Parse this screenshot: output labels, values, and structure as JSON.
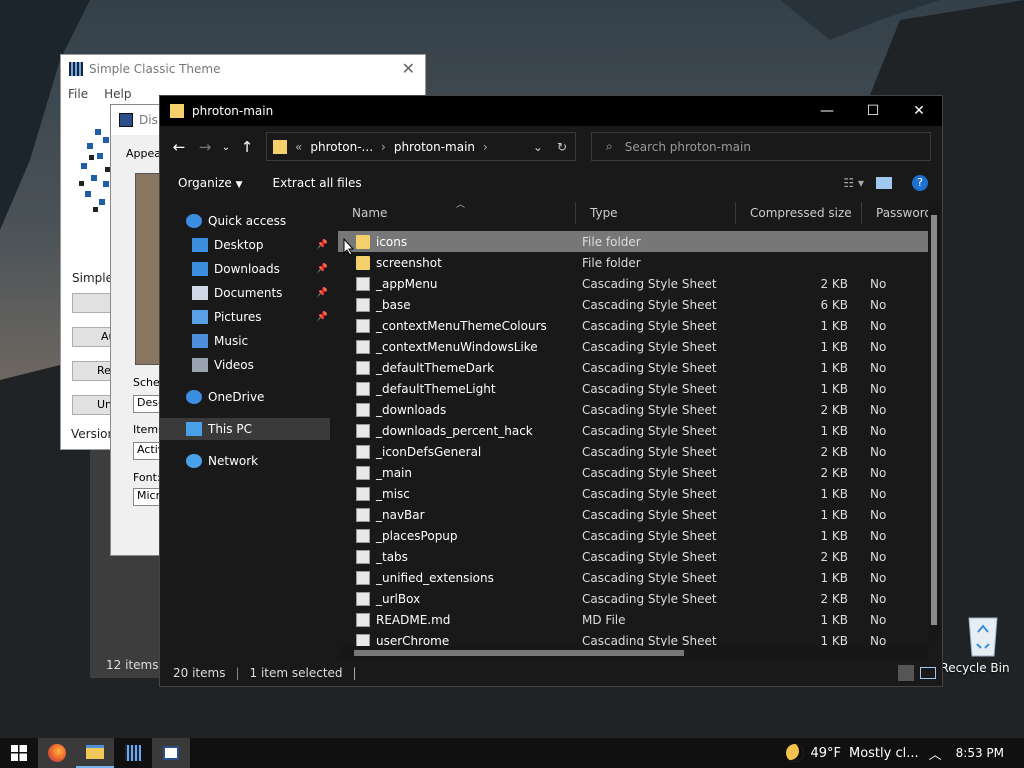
{
  "desktop": {
    "recycle_bin": "Recycle Bin"
  },
  "sct": {
    "title": "Simple Classic Theme",
    "menu": [
      "File",
      "Help"
    ],
    "label_simple": "Simple C",
    "btn1": "Au",
    "btn2": "Res",
    "btn3": "Uni",
    "version": "Version"
  },
  "display": {
    "title": "Dis",
    "appear": "Appear",
    "scheme": "Sche",
    "scheme_val": "Dese",
    "item": "Item:",
    "item_val": "Activ",
    "font": "Font:",
    "font_val": "Micro"
  },
  "behind": {
    "status": "12 items"
  },
  "explorer": {
    "title": "phroton-main",
    "breadcrumb": [
      "phroton-...",
      "phroton-main"
    ],
    "breadcrumb_prefix": "«",
    "search_placeholder": "Search phroton-main",
    "commands": {
      "organize": "Organize",
      "extract": "Extract all files"
    },
    "nav": [
      {
        "label": "Quick access",
        "icon": "star-icon",
        "color": "#3b8ee0",
        "pinned": false
      },
      {
        "label": "Desktop",
        "icon": "desktop-icon",
        "color": "#3b8ee0",
        "pinned": true
      },
      {
        "label": "Downloads",
        "icon": "download-icon",
        "color": "#3b8ee0",
        "pinned": true
      },
      {
        "label": "Documents",
        "icon": "document-icon",
        "color": "#cfd8e4",
        "pinned": true
      },
      {
        "label": "Pictures",
        "icon": "picture-icon",
        "color": "#5aa0e6",
        "pinned": true
      },
      {
        "label": "Music",
        "icon": "music-icon",
        "color": "#4e8fdc",
        "pinned": false
      },
      {
        "label": "Videos",
        "icon": "video-icon",
        "color": "#9aa4b0",
        "pinned": false
      },
      {
        "label": "OneDrive",
        "icon": "cloud-icon",
        "color": "#3b8ee0",
        "pinned": false
      },
      {
        "label": "This PC",
        "icon": "computer-icon",
        "color": "#4aa0e8",
        "pinned": false
      },
      {
        "label": "Network",
        "icon": "network-icon",
        "color": "#4aa0e8",
        "pinned": false
      }
    ],
    "columns": {
      "name": "Name",
      "type": "Type",
      "size": "Compressed size",
      "password": "Password ."
    },
    "files": [
      {
        "name": "icons",
        "type": "File folder",
        "size": "",
        "password": "",
        "kind": "folder",
        "selected": true
      },
      {
        "name": "screenshot",
        "type": "File folder",
        "size": "",
        "password": "",
        "kind": "folder"
      },
      {
        "name": "_appMenu",
        "type": "Cascading Style Sheet Do...",
        "size": "2 KB",
        "password": "No",
        "kind": "css"
      },
      {
        "name": "_base",
        "type": "Cascading Style Sheet Do...",
        "size": "6 KB",
        "password": "No",
        "kind": "css"
      },
      {
        "name": "_contextMenuThemeColours",
        "type": "Cascading Style Sheet Do...",
        "size": "1 KB",
        "password": "No",
        "kind": "css"
      },
      {
        "name": "_contextMenuWindowsLike",
        "type": "Cascading Style Sheet Do...",
        "size": "1 KB",
        "password": "No",
        "kind": "css"
      },
      {
        "name": "_defaultThemeDark",
        "type": "Cascading Style Sheet Do...",
        "size": "1 KB",
        "password": "No",
        "kind": "css"
      },
      {
        "name": "_defaultThemeLight",
        "type": "Cascading Style Sheet Do...",
        "size": "1 KB",
        "password": "No",
        "kind": "css"
      },
      {
        "name": "_downloads",
        "type": "Cascading Style Sheet Do...",
        "size": "2 KB",
        "password": "No",
        "kind": "css"
      },
      {
        "name": "_downloads_percent_hack",
        "type": "Cascading Style Sheet Do...",
        "size": "1 KB",
        "password": "No",
        "kind": "css"
      },
      {
        "name": "_iconDefsGeneral",
        "type": "Cascading Style Sheet Do...",
        "size": "2 KB",
        "password": "No",
        "kind": "css"
      },
      {
        "name": "_main",
        "type": "Cascading Style Sheet Do...",
        "size": "2 KB",
        "password": "No",
        "kind": "css"
      },
      {
        "name": "_misc",
        "type": "Cascading Style Sheet Do...",
        "size": "1 KB",
        "password": "No",
        "kind": "css"
      },
      {
        "name": "_navBar",
        "type": "Cascading Style Sheet Do...",
        "size": "1 KB",
        "password": "No",
        "kind": "css"
      },
      {
        "name": "_placesPopup",
        "type": "Cascading Style Sheet Do...",
        "size": "1 KB",
        "password": "No",
        "kind": "css"
      },
      {
        "name": "_tabs",
        "type": "Cascading Style Sheet Do...",
        "size": "2 KB",
        "password": "No",
        "kind": "css"
      },
      {
        "name": "_unified_extensions",
        "type": "Cascading Style Sheet Do...",
        "size": "1 KB",
        "password": "No",
        "kind": "css"
      },
      {
        "name": "_urlBox",
        "type": "Cascading Style Sheet Do...",
        "size": "2 KB",
        "password": "No",
        "kind": "css"
      },
      {
        "name": "README.md",
        "type": "MD File",
        "size": "1 KB",
        "password": "No",
        "kind": "md"
      },
      {
        "name": "userChrome",
        "type": "Cascading Style Sheet Do...",
        "size": "1 KB",
        "password": "No",
        "kind": "css"
      }
    ],
    "status": {
      "count": "20 items",
      "selected": "1 item selected"
    }
  },
  "taskbar": {
    "weather_temp": "49°F",
    "weather_text": "Mostly cl...",
    "time": "8:53 PM"
  }
}
